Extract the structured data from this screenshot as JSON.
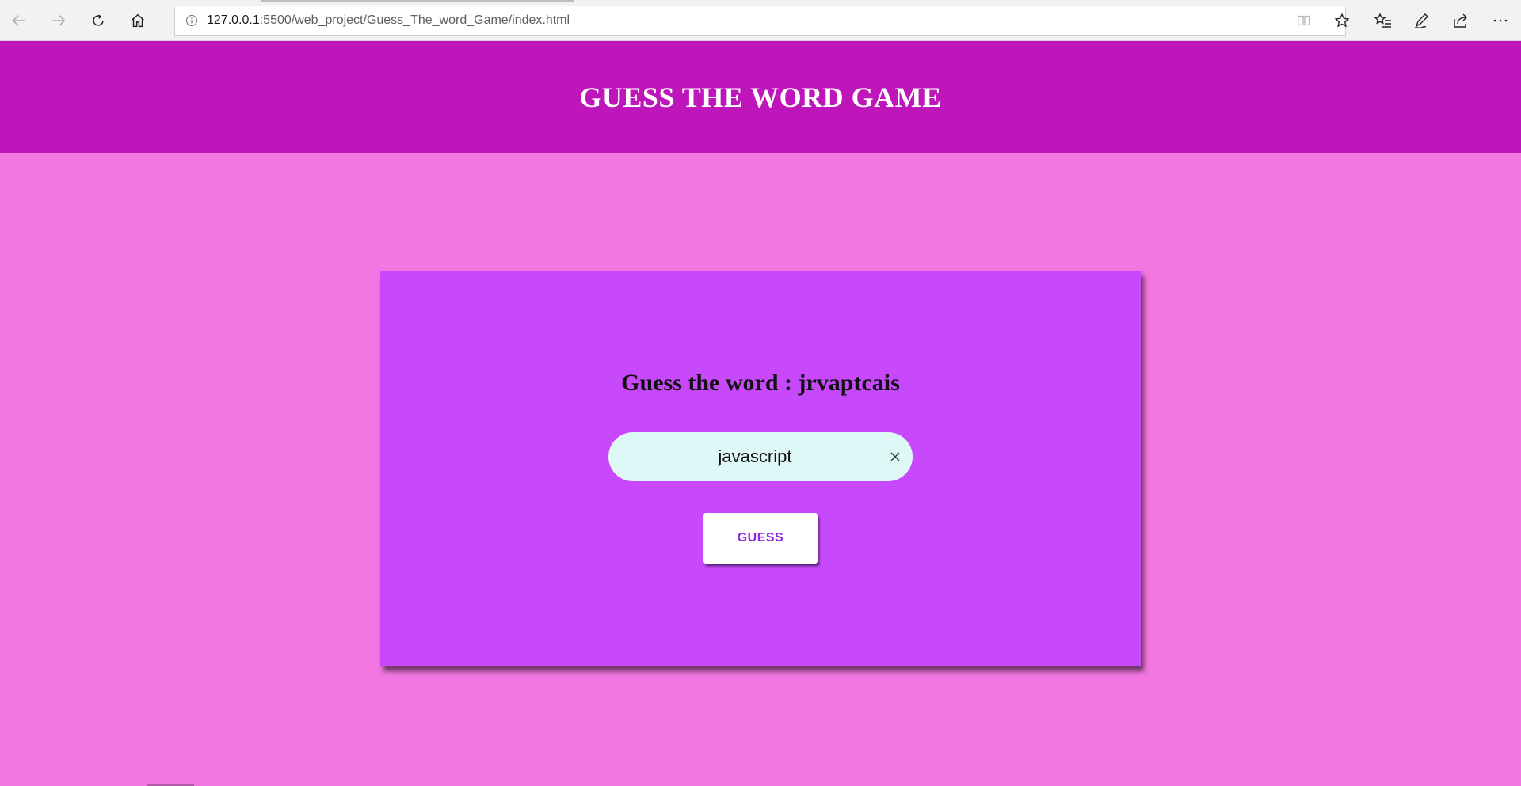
{
  "browser": {
    "url_host": "127.0.0.1",
    "url_path": ":5500/web_project/Guess_The_word_Game/index.html",
    "icons": {
      "back": "back-arrow-icon",
      "forward": "forward-arrow-icon",
      "refresh": "refresh-icon",
      "home": "home-icon",
      "info": "info-icon",
      "reading_view": "reading-view-icon",
      "favorite": "star-icon",
      "favorites_hub": "favorites-list-icon",
      "notes": "pen-icon",
      "share": "share-icon",
      "more": "more-icon"
    }
  },
  "page": {
    "header_title": "GUESS THE WORD GAME",
    "prompt": "Guess the word : jrvaptcais",
    "input_value": "javascript",
    "guess_button": "GUESS",
    "colors": {
      "header_bg": "#bf16bb",
      "page_bg": "#f277e0",
      "card_bg": "#c749fb",
      "input_bg": "#def7f7",
      "button_text": "#8a2be2"
    }
  }
}
